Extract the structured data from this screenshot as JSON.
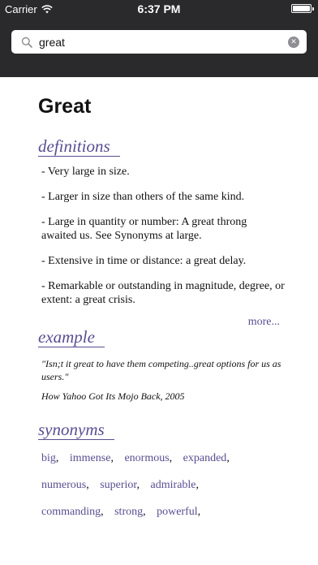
{
  "status_bar": {
    "carrier": "Carrier",
    "time": "6:37 PM",
    "battery_level": 1.0
  },
  "search": {
    "value": "great",
    "placeholder": ""
  },
  "entry": {
    "word": "Great",
    "definitions_heading": "definitions",
    "definitions": [
      "- Very large in size.",
      "- Larger in size than others of the same kind.",
      "- Large in quantity or number:  A great throng awaited us.  See Synonyms at large.",
      "- Extensive in time or distance:  a great delay.",
      "- Remarkable or outstanding in magnitude, degree, or extent:  a great crisis."
    ],
    "more_label": "more...",
    "example_heading": "example",
    "example_quote": "\"Isn;t it great to have them competing..great options for us as users.\"",
    "example_source": "How Yahoo Got Its Mojo Back, 2005",
    "synonyms_heading": "synonyms",
    "synonyms": [
      "big",
      "immense",
      "enormous",
      "expanded",
      "numerous",
      "superior",
      "admirable",
      "commanding",
      "strong",
      "powerful"
    ]
  },
  "colors": {
    "header_bg": "#2a2a2c",
    "accent": "#5a4d91",
    "text": "#111111"
  },
  "icons": [
    "wifi-icon",
    "battery-icon",
    "search-icon",
    "clear-icon"
  ]
}
